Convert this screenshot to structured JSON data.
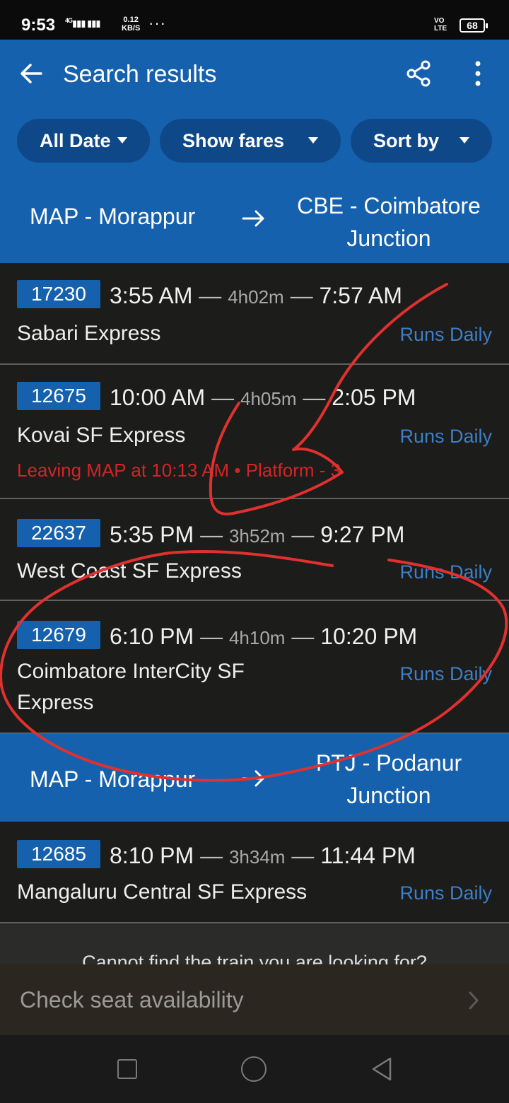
{
  "status_bar": {
    "time": "9:53",
    "network": "4G",
    "speed_value": "0.12",
    "speed_unit": "KB/S",
    "more": "···",
    "volte": "VO LTE",
    "battery": "68"
  },
  "header": {
    "title": "Search results",
    "icons": [
      "back-arrow-icon",
      "share-icon",
      "more-vert-icon"
    ],
    "filters": [
      {
        "label": "All Date"
      },
      {
        "label": "Show fares"
      },
      {
        "label": "Sort by"
      }
    ],
    "accent": "#1561ad",
    "chip_bg": "#0e4888"
  },
  "routes": [
    {
      "from": "MAP - Morappur",
      "to": "CBE - Coimbatore Junction",
      "trains": [
        {
          "number": "17230",
          "depart": "3:55 AM",
          "duration": "4h02m",
          "arrive": "7:57 AM",
          "name": "Sabari Express",
          "runs": "Runs Daily"
        },
        {
          "number": "12675",
          "depart": "10:00 AM",
          "duration": "4h05m",
          "arrive": "2:05 PM",
          "name": "Kovai SF Express",
          "runs": "Runs Daily",
          "note": "Leaving MAP at 10:13 AM • Platform - 3"
        },
        {
          "number": "22637",
          "depart": "5:35 PM",
          "duration": "3h52m",
          "arrive": "9:27 PM",
          "name": "West Coast SF Express",
          "runs": "Runs Daily"
        },
        {
          "number": "12679",
          "depart": "6:10 PM",
          "duration": "4h10m",
          "arrive": "10:20 PM",
          "name": "Coimbatore InterCity SF Express",
          "runs": "Runs Daily"
        }
      ]
    },
    {
      "from": "MAP - Morappur",
      "to": "PTJ - Podanur Junction",
      "trains": [
        {
          "number": "12685",
          "depart": "8:10 PM",
          "duration": "3h34m",
          "arrive": "11:44 PM",
          "name": "Mangaluru Central SF Express",
          "runs": "Runs Daily"
        }
      ]
    }
  ],
  "footer": {
    "cannot_find": "Cannot find the train you are looking for?",
    "check_seat": "Check seat availability"
  },
  "colors": {
    "runs_daily": "#3d7fc9",
    "alert": "#d32525",
    "annotation": "#e0312f"
  }
}
